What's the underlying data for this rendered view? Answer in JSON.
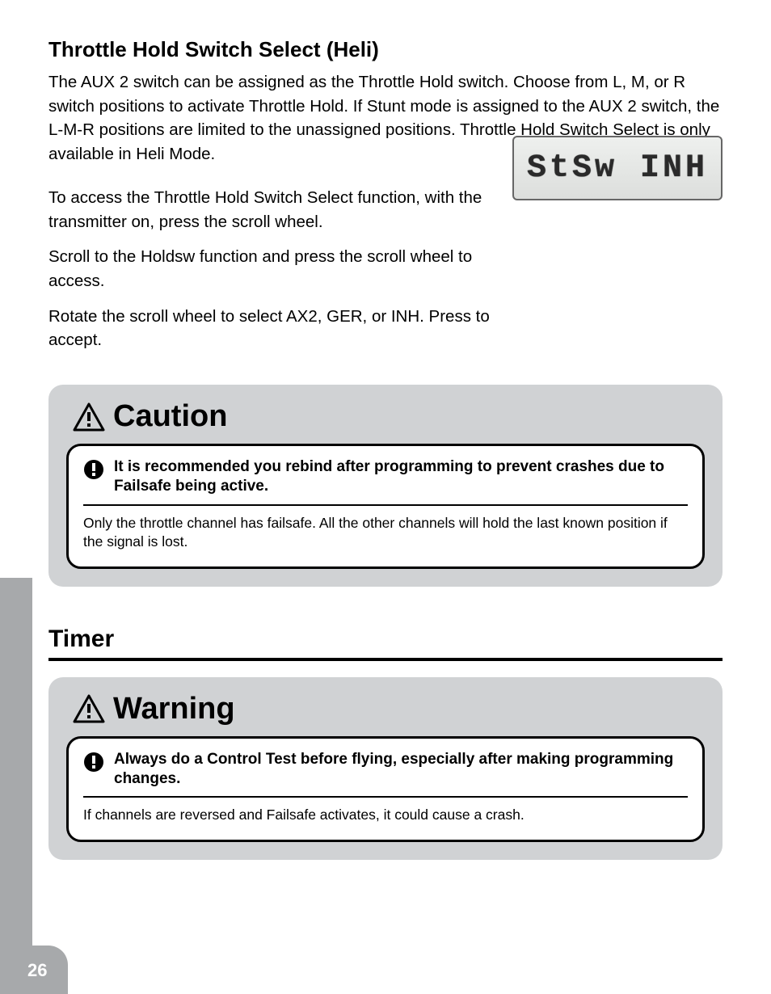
{
  "heliSwitch": {
    "heading": "Throttle Hold Switch Select (Heli)",
    "body": "The AUX 2 switch can be assigned as the Throttle Hold switch. Choose from L, M, or R switch positions to activate Throttle Hold. If Stunt mode is assigned to the AUX 2 switch, the L-M-R positions are limited to the unassigned positions. Throttle Hold Switch Select is only available in Heli Mode."
  },
  "lcd": {
    "text": "StSw INH"
  },
  "paragraphs": {
    "p1": "To access the Throttle Hold Switch Select function, with the transmitter on, press the scroll wheel.",
    "p2": "Scroll to the Holdsw function and press the scroll wheel to access.",
    "p3": "Rotate the scroll wheel to select AX2, GER, or INH. Press to accept."
  },
  "caution": {
    "title": "Caution",
    "headline": "It is recommended you rebind after programming to prevent crashes due to Failsafe being active.",
    "desc": "Only the throttle channel has failsafe. All the other channels will hold the last known position if the signal is lost."
  },
  "timer": {
    "heading": "Timer"
  },
  "warning": {
    "title": "Warning",
    "headline": "Always do a Control Test before flying, especially after making programming changes.",
    "desc": "If channels are reversed and Failsafe activates, it could cause a crash."
  },
  "pageNumber": "26"
}
